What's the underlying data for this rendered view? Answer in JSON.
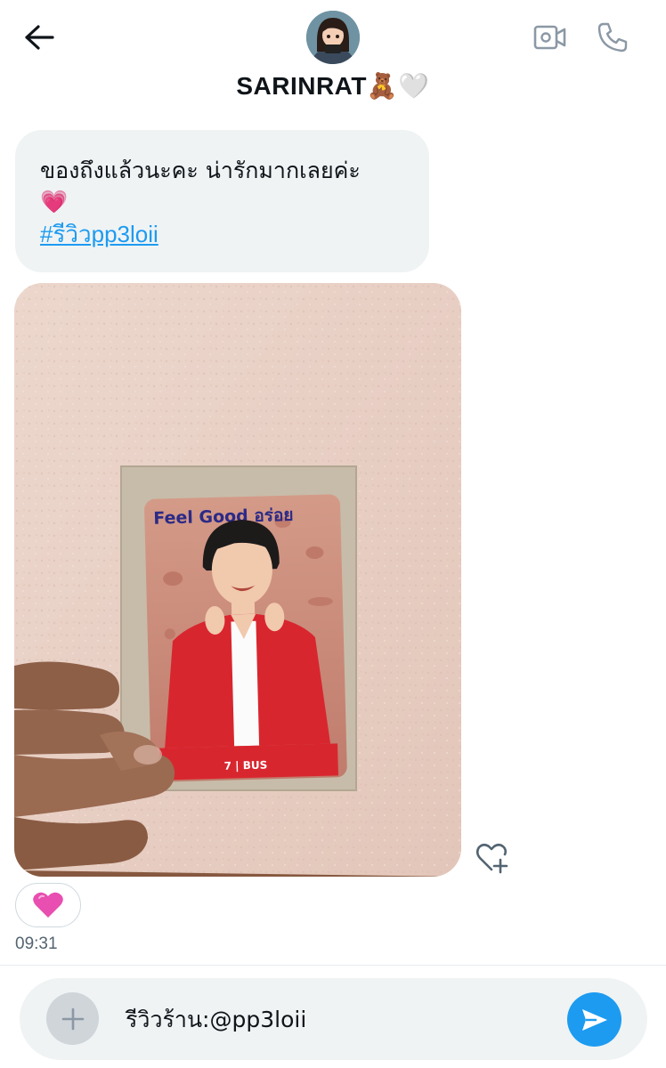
{
  "header": {
    "contact_name": "SARINRAT🧸🤍",
    "back_icon": "arrow-left-icon",
    "video_icon": "video-camera-icon",
    "call_icon": "phone-icon"
  },
  "messages": {
    "text_bubble": {
      "text": "ของถึงแล้วนะคะ น่ารักมากเลยค่ะ\n💗",
      "hashtag": "#รีวิวpp3loii"
    },
    "photo": {
      "card_brand": "Feel Good อร่อย",
      "card_footer": "7 | BUS"
    },
    "reaction_emoji": "💗",
    "timestamp": "09:31"
  },
  "composer": {
    "text": "รีวิวร้าน:@pp3loii",
    "plus_icon": "plus-icon",
    "send_icon": "send-arrow-icon"
  },
  "colors": {
    "accent": "#1d9bf0",
    "bubble_bg": "#eff3f4",
    "card_bg": "#c98a7a",
    "shirt": "#d8262f",
    "wall": "#e9d1c7"
  }
}
